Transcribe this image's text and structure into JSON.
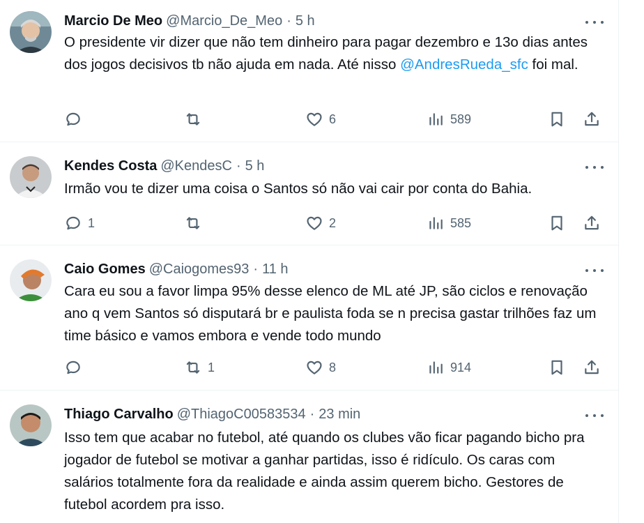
{
  "tweets": [
    {
      "name": "Marcio De Meo",
      "handle": "@Marcio_De_Meo",
      "time": "5 h",
      "text_before": "O presidente vir dizer que não tem dinheiro para pagar dezembro e 13o dias antes dos jogos decisivos tb não ajuda em nada. Até nisso ",
      "mention": "@AndresRueda_sfc",
      "text_after": " foi mal.",
      "replies": "",
      "retweets": "",
      "likes": "6",
      "views": "589"
    },
    {
      "name": "Kendes Costa",
      "handle": "@KendesC",
      "time": "5 h",
      "text_before": "Irmão vou te dizer uma coisa o Santos só não vai cair por conta do Bahia.",
      "mention": "",
      "text_after": "",
      "replies": "1",
      "retweets": "",
      "likes": "2",
      "views": "585"
    },
    {
      "name": "Caio Gomes",
      "handle": "@Caiogomes93",
      "time": "11 h",
      "text_before": "Cara eu sou a favor limpa 95% desse elenco de ML até JP, são ciclos e renovação ano q vem Santos só disputará br e paulista foda se n precisa gastar trilhões faz um time básico e vamos embora e vende todo mundo",
      "mention": "",
      "text_after": "",
      "replies": "",
      "retweets": "1",
      "likes": "8",
      "views": "914"
    },
    {
      "name": "Thiago Carvalho",
      "handle": "@ThiagoC00583534",
      "time": "23 min",
      "text_before": "Isso tem que acabar no futebol, até quando os clubes vão ficar pagando bicho pra jogador de futebol se motivar a ganhar partidas, isso é ridículo. Os caras com salários totalmente fora da realidade e ainda assim querem bicho. Gestores de futebol acordem pra isso.",
      "mention": "",
      "text_after": "",
      "replies": "",
      "retweets": "",
      "likes": "",
      "views": ""
    }
  ],
  "icons": {
    "reply": "reply-icon",
    "retweet": "retweet-icon",
    "like": "heart-icon",
    "views": "views-icon",
    "bookmark": "bookmark-icon",
    "share": "share-icon",
    "more": "more-icon"
  },
  "colors": {
    "text": "#0f1419",
    "secondary": "#536471",
    "mention": "#1d9bf0",
    "divider": "#eff3f4"
  }
}
